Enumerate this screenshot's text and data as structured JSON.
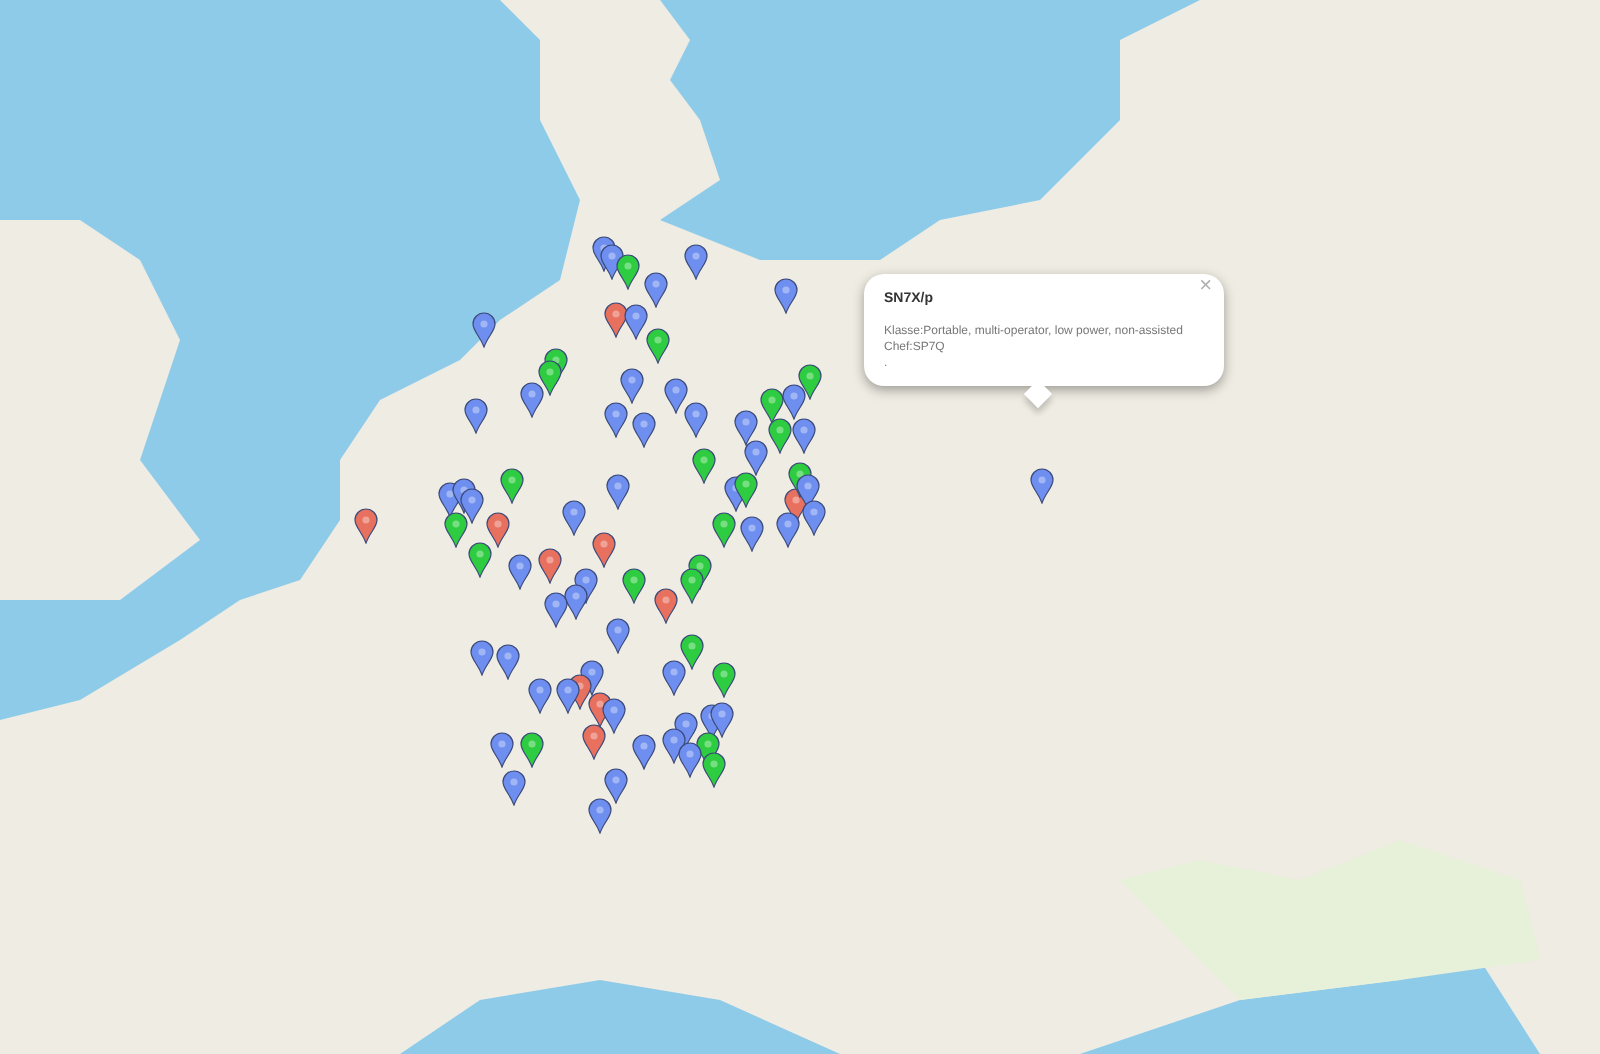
{
  "map": {
    "pins": [
      {
        "color": "#6f8ff0"
      },
      {
        "color": "#6f8ff0"
      },
      {
        "color": "#6f8ff0"
      },
      {
        "color": "#2ecc40"
      },
      {
        "color": "#6f8ff0"
      },
      {
        "color": "#6f8ff0"
      },
      {
        "color": "#e8705f"
      },
      {
        "color": "#6f8ff0"
      },
      {
        "color": "#2ecc40"
      },
      {
        "color": "#2ecc40"
      },
      {
        "color": "#2ecc40"
      },
      {
        "color": "#6f8ff0"
      },
      {
        "color": "#6f8ff0"
      },
      {
        "color": "#6f8ff0"
      },
      {
        "color": "#6f8ff0"
      },
      {
        "color": "#6f8ff0"
      },
      {
        "color": "#6f8ff0"
      },
      {
        "color": "#6f8ff0"
      },
      {
        "color": "#2ecc40"
      },
      {
        "color": "#6f8ff0"
      },
      {
        "color": "#2ecc40"
      },
      {
        "color": "#6f8ff0"
      },
      {
        "color": "#2ecc40"
      },
      {
        "color": "#6f8ff0"
      },
      {
        "color": "#6f8ff0"
      },
      {
        "color": "#6f8ff0"
      },
      {
        "color": "#e8705f"
      },
      {
        "color": "#2ecc40"
      },
      {
        "color": "#6f8ff0"
      },
      {
        "color": "#6f8ff0"
      },
      {
        "color": "#6f8ff0"
      },
      {
        "color": "#2ecc40"
      },
      {
        "color": "#6f8ff0"
      },
      {
        "color": "#2ecc40"
      },
      {
        "color": "#2ecc40"
      },
      {
        "color": "#6f8ff0"
      },
      {
        "color": "#6f8ff0"
      },
      {
        "color": "#6f8ff0"
      },
      {
        "color": "#6f8ff0"
      },
      {
        "color": "#6f8ff0"
      },
      {
        "color": "#6f8ff0"
      },
      {
        "color": "#e8705f"
      },
      {
        "color": "#2ecc40"
      },
      {
        "color": "#2ecc40"
      },
      {
        "color": "#2ecc40"
      },
      {
        "color": "#e8705f"
      },
      {
        "color": "#6f8ff0"
      },
      {
        "color": "#e8705f"
      },
      {
        "color": "#e8705f"
      },
      {
        "color": "#2ecc40"
      },
      {
        "color": "#2ecc40"
      },
      {
        "color": "#e8705f"
      },
      {
        "color": "#2ecc40"
      },
      {
        "color": "#6f8ff0"
      },
      {
        "color": "#6f8ff0"
      },
      {
        "color": "#6f8ff0"
      },
      {
        "color": "#6f8ff0"
      },
      {
        "color": "#2ecc40"
      },
      {
        "color": "#6f8ff0"
      },
      {
        "color": "#2ecc40"
      },
      {
        "color": "#6f8ff0"
      },
      {
        "color": "#6f8ff0"
      },
      {
        "color": "#6f8ff0"
      },
      {
        "color": "#e8705f"
      },
      {
        "color": "#e8705f"
      },
      {
        "color": "#6f8ff0"
      },
      {
        "color": "#6f8ff0"
      },
      {
        "color": "#6f8ff0"
      },
      {
        "color": "#6f8ff0"
      },
      {
        "color": "#6f8ff0"
      },
      {
        "color": "#6f8ff0"
      },
      {
        "color": "#6f8ff0"
      },
      {
        "color": "#2ecc40"
      },
      {
        "color": "#6f8ff0"
      },
      {
        "color": "#2ecc40"
      },
      {
        "color": "#e8705f"
      },
      {
        "color": "#6f8ff0"
      },
      {
        "color": "#2ecc40"
      },
      {
        "color": "#6f8ff0"
      },
      {
        "color": "#6f8ff0"
      },
      {
        "color": "#6f8ff0"
      },
      {
        "color": "#6f8ff0"
      },
      {
        "color": "#6f8ff0"
      }
    ]
  },
  "popup": {
    "title": "SN7X/p",
    "lines": [
      "Klasse:Portable, multi-operator, low power, non-assisted",
      "Chef:SP7Q",
      "."
    ],
    "close": "×"
  }
}
